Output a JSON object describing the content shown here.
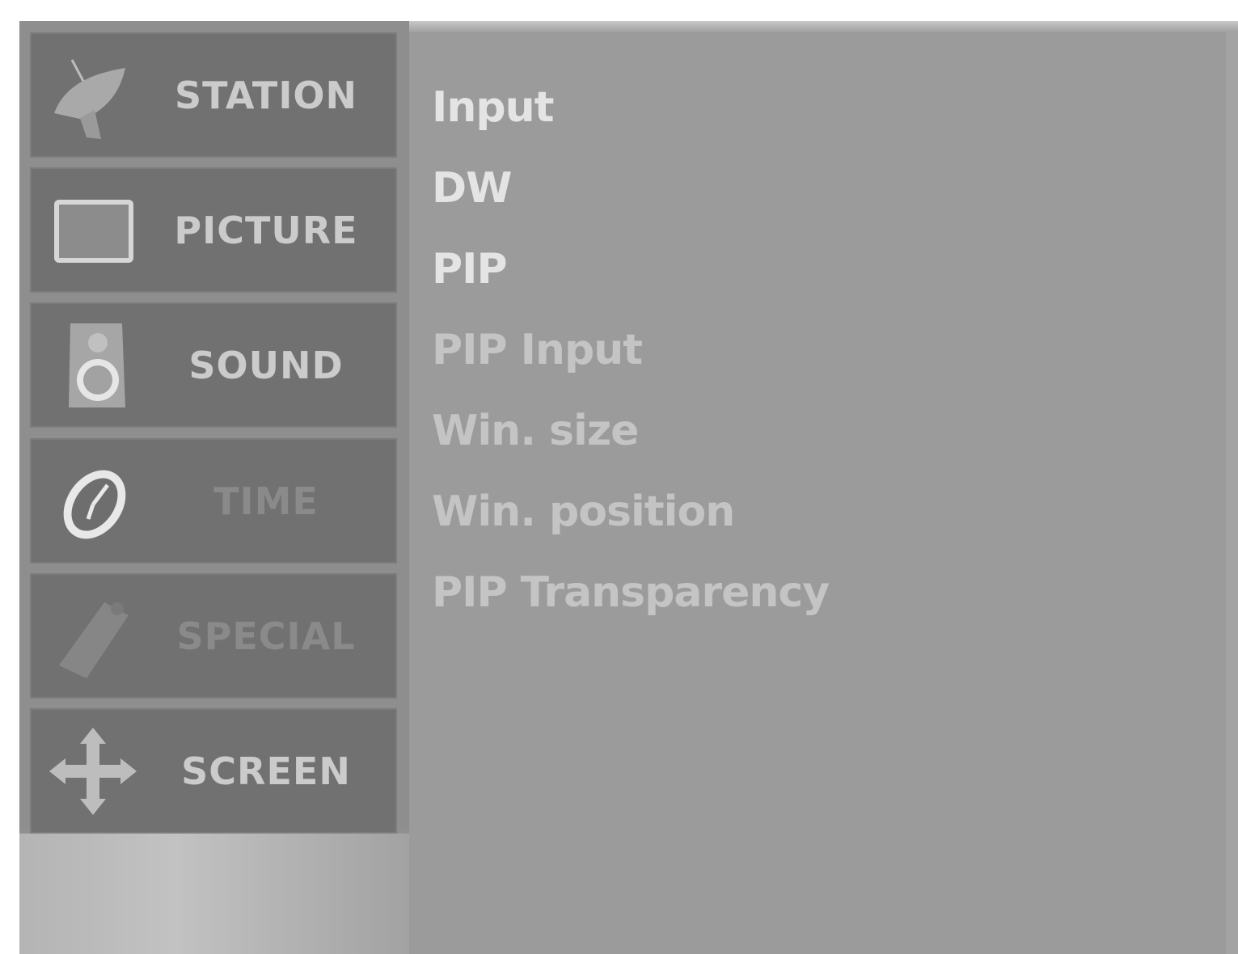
{
  "sidebar": {
    "items": [
      {
        "label": "STATION",
        "icon": "satellite-dish-icon"
      },
      {
        "label": "PICTURE",
        "icon": "tv-screen-icon"
      },
      {
        "label": "SOUND",
        "icon": "speaker-icon"
      },
      {
        "label": "TIME",
        "icon": "clock-icon"
      },
      {
        "label": "SPECIAL",
        "icon": "tag-icon"
      },
      {
        "label": "SCREEN",
        "icon": "move-arrows-icon"
      }
    ]
  },
  "menu": {
    "options": [
      {
        "label": "Input",
        "enabled": true
      },
      {
        "label": "DW",
        "enabled": true
      },
      {
        "label": "PIP",
        "enabled": true
      },
      {
        "label": "PIP Input",
        "enabled": false
      },
      {
        "label": "Win. size",
        "enabled": false
      },
      {
        "label": "Win. position",
        "enabled": false
      },
      {
        "label": "PIP Transparency",
        "enabled": false
      }
    ]
  },
  "colors": {
    "panel": "#9b9b9b",
    "sidebar_item": "#717171",
    "text_active": "#e4e4e4",
    "text_inactive": "#c4c4c4"
  }
}
